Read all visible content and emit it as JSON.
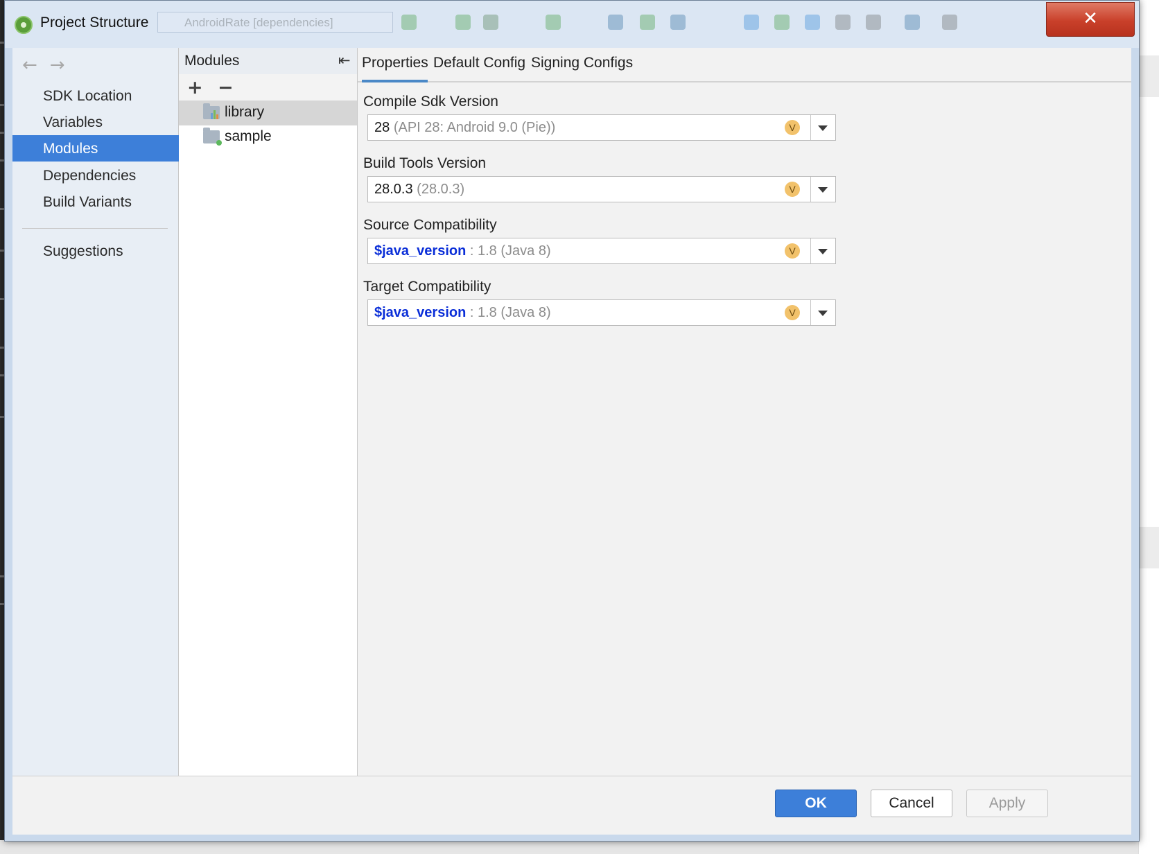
{
  "window": {
    "title": "Project Structure",
    "close_glyph": "✕",
    "background_toolbar_config": "AndroidRate [dependencies]"
  },
  "nav": {
    "back_glyph": "←",
    "forward_glyph": "→",
    "items": [
      {
        "label": "SDK Location"
      },
      {
        "label": "Variables"
      },
      {
        "label": "Modules",
        "selected": true
      },
      {
        "label": "Dependencies"
      },
      {
        "label": "Build Variants"
      }
    ],
    "suggestions_label": "Suggestions"
  },
  "modules": {
    "header": "Modules",
    "collapse_glyph": "⇤",
    "add_glyph": "+",
    "remove_glyph": "−",
    "items": [
      {
        "name": "library",
        "selected": true
      },
      {
        "name": "sample"
      }
    ]
  },
  "tabs": [
    {
      "label": "Properties",
      "active": true
    },
    {
      "label": "Default Config"
    },
    {
      "label": "Signing Configs"
    }
  ],
  "properties": {
    "compile_sdk": {
      "label": "Compile Sdk Version",
      "value": "28",
      "hint": "(API 28: Android 9.0 (Pie))",
      "badge": "V"
    },
    "build_tools": {
      "label": "Build Tools Version",
      "value": "28.0.3",
      "hint": "(28.0.3)",
      "badge": "V"
    },
    "source_compat": {
      "label": "Source Compatibility",
      "variable": "$java_version",
      "hint": ": 1.8 (Java 8)",
      "badge": "V"
    },
    "target_compat": {
      "label": "Target Compatibility",
      "variable": "$java_version",
      "hint": ": 1.8 (Java 8)",
      "badge": "V"
    }
  },
  "footer": {
    "ok_label": "OK",
    "cancel_label": "Cancel",
    "apply_label": "Apply"
  },
  "colors": {
    "selection_blue": "#3d7fd9",
    "variable_blue": "#0a2ed8",
    "badge_orange": "#f2c26b",
    "close_red": "#c9402a"
  }
}
